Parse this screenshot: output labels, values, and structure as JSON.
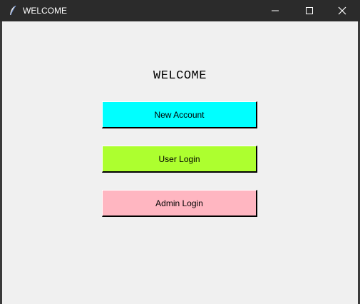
{
  "window": {
    "title": "WELCOME",
    "controls": {
      "minimize_icon": "minimize-icon",
      "maximize_icon": "maximize-icon",
      "close_icon": "close-icon"
    }
  },
  "main": {
    "heading": "WELCOME",
    "buttons": [
      {
        "label": "New Account",
        "color": "#00ffff"
      },
      {
        "label": "User Login",
        "color": "#adff2f"
      },
      {
        "label": "Admin Login",
        "color": "#ffb6c1"
      }
    ]
  },
  "colors": {
    "titlebar": "#2b2b2b",
    "background": "#f0f0f0"
  }
}
